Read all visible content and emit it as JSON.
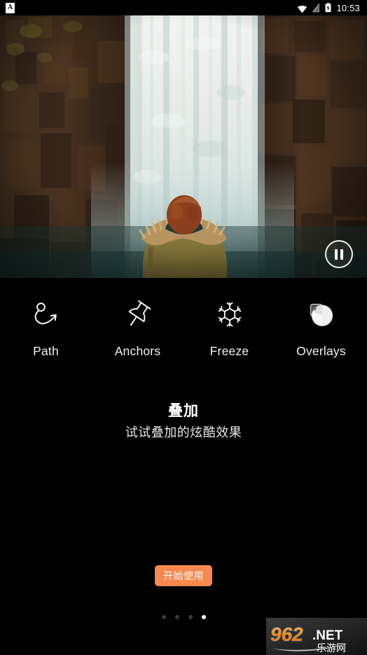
{
  "statusbar": {
    "app_badge_letter": "A",
    "icons": [
      "app-notification-icon",
      "wifi-icon",
      "sim-off-icon",
      "battery-charging-icon"
    ],
    "time": "10:53"
  },
  "hero": {
    "media_type": "video",
    "scene_description": "waterfall between dark rocky cliffs with a person in a fur-hooded parka",
    "control": {
      "name": "pause-button",
      "state": "playing",
      "label": "Pause"
    }
  },
  "features": [
    {
      "icon": "path-icon",
      "label": "Path"
    },
    {
      "icon": "anchors-icon",
      "label": "Anchors"
    },
    {
      "icon": "freeze-icon",
      "label": "Freeze"
    },
    {
      "icon": "overlays-icon",
      "label": "Overlays"
    }
  ],
  "title": {
    "heading": "叠加",
    "subheading": "试试叠加的炫酷效果"
  },
  "cta": {
    "label": "开始使用",
    "color": "#F8884E",
    "text_color": "#FFFFFF"
  },
  "pager": {
    "total": 4,
    "active_index": 3,
    "active_color": "#FFFFFF",
    "inactive_color": "#3A3A3A"
  },
  "watermark": {
    "number": "962",
    "domain": ".NET",
    "chinese": "乐游网",
    "number_color": "#F08B1D",
    "domain_color": "#FFFFFF"
  },
  "theme": {
    "background": "#000000",
    "text_primary": "#FFFFFF",
    "text_secondary": "#E6E6E6",
    "accent": "#F8884E"
  }
}
